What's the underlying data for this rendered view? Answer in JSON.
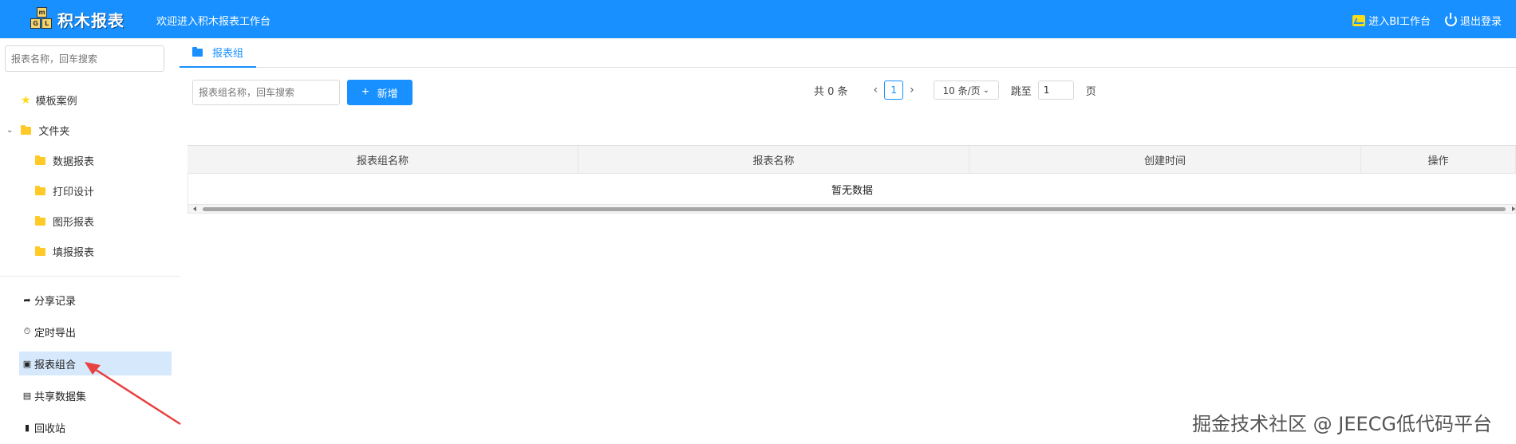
{
  "header": {
    "logo_text": "积木报表",
    "logo_blocks": [
      "m",
      "G",
      "L"
    ],
    "welcome": "欢迎进入积木报表工作台",
    "bi_link": "进入BI工作台",
    "logout": "退出登录"
  },
  "sidebar": {
    "search_placeholder": "报表名称，回车搜索",
    "tree": {
      "template": "模板案例",
      "folder": "文件夹",
      "children": [
        "数据报表",
        "打印设计",
        "图形报表",
        "填报报表"
      ]
    },
    "menu": [
      {
        "label": "分享记录",
        "icon": "share-icon"
      },
      {
        "label": "定时导出",
        "icon": "clock-icon"
      },
      {
        "label": "报表组合",
        "icon": "folder-icon",
        "active": true
      },
      {
        "label": "共享数据集",
        "icon": "database-icon"
      },
      {
        "label": "回收站",
        "icon": "trash-icon"
      }
    ]
  },
  "main": {
    "tab": "报表组",
    "search_placeholder": "报表组名称，回车搜索",
    "add_button": "新增",
    "pager": {
      "total": "共 0 条",
      "current_page": "1",
      "page_size": "10 条/页",
      "jump_label": "跳至",
      "jump_value": "1",
      "page_unit": "页"
    },
    "table": {
      "columns": [
        "报表组名称",
        "报表名称",
        "创建时间",
        "操作"
      ],
      "empty_text": "暂无数据"
    }
  },
  "watermark": "掘金技术社区 @ JEECG低代码平台",
  "colors": {
    "primary": "#1890ff",
    "active_bg": "#d6e8fb",
    "folder": "#ffca28"
  }
}
